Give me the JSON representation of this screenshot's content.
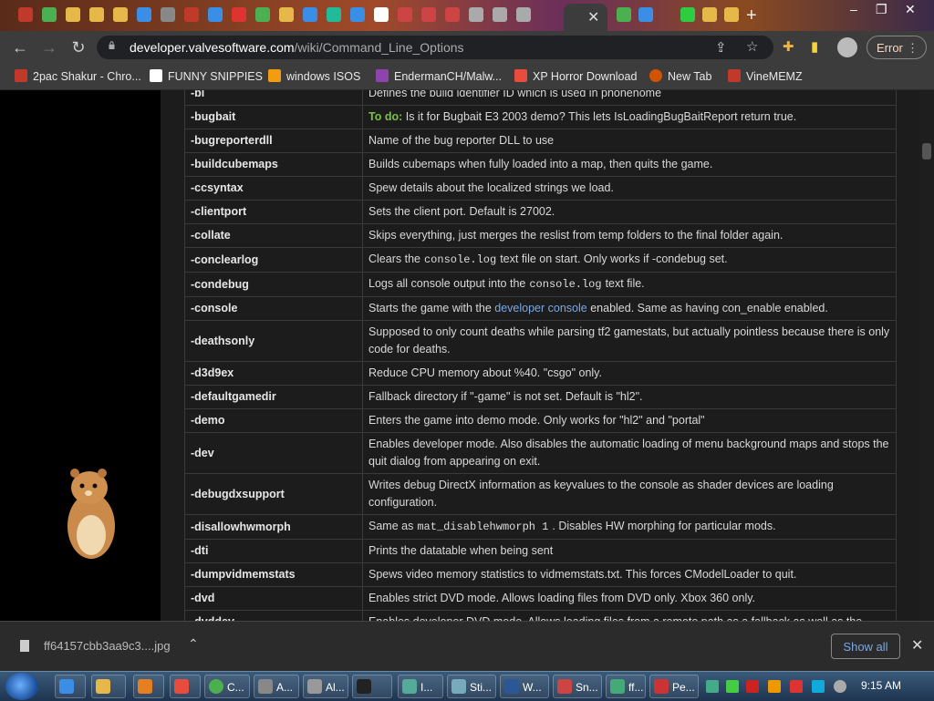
{
  "browser": {
    "url_host": "developer.valvesoftware.com",
    "url_path": "/wiki/Command_Line_Options",
    "error_label": "Error"
  },
  "bookmarks": [
    {
      "label": "2pac Shakur - Chro...",
      "color": "#c0392b"
    },
    {
      "label": "FUNNY SNIPPIES",
      "color": "#ffffff"
    },
    {
      "label": "windows ISOS",
      "color": "#f39c12"
    },
    {
      "label": "EndermanCH/Malw...",
      "color": "#8e44ad"
    },
    {
      "label": "XP Horror Download",
      "color": "#e74c3c"
    },
    {
      "label": "New Tab",
      "color": "#d35400"
    },
    {
      "label": "VineMEMZ",
      "color": "#c0392b"
    }
  ],
  "table": {
    "rows": [
      {
        "name": "-bi",
        "desc": "Defines the build identifier ID which is used in phonehome"
      },
      {
        "name": "-bugbait",
        "todo": "To do:",
        "desc": " Is it for Bugbait E3 2003 demo? This lets IsLoadingBugBaitReport return true."
      },
      {
        "name": "-bugreporterdll",
        "desc": "Name of the bug reporter DLL to use"
      },
      {
        "name": "-buildcubemaps",
        "desc": "Builds cubemaps when fully loaded into a map, then quits the game."
      },
      {
        "name": "-ccsyntax",
        "desc": "Spew details about the localized strings we load."
      },
      {
        "name": "-clientport",
        "desc": "Sets the client port. Default is 27002."
      },
      {
        "name": "-collate",
        "desc": "Skips everything, just merges the reslist from temp folders to the final folder again."
      },
      {
        "name": "-conclearlog",
        "pre": "Clears the",
        "code": "console.log",
        "post": "text file on start. Only works if -condebug set."
      },
      {
        "name": "-condebug",
        "pre": "Logs all console output into the",
        "code": "console.log",
        "post": "text file."
      },
      {
        "name": "-console",
        "pre": "Starts the game with the ",
        "link": "developer console",
        "post": " enabled. Same as having con_enable enabled."
      },
      {
        "name": "-deathsonly",
        "desc": "Supposed to only count deaths while parsing tf2 gamestats, but actually pointless because there is only code for deaths."
      },
      {
        "name": "-d3d9ex",
        "desc": "Reduce CPU memory about %40. \"csgo\" only."
      },
      {
        "name": "-defaultgamedir",
        "desc": "Fallback directory if \"-game\" is not set. Default is \"hl2\"."
      },
      {
        "name": "-demo",
        "desc": "Enters the game into demo mode. Only works for \"hl2\" and \"portal\""
      },
      {
        "name": "-dev",
        "desc": "Enables developer mode. Also disables the automatic loading of menu background maps and stops the quit dialog from appearing on exit."
      },
      {
        "name": "-debugdxsupport",
        "desc": "Writes debug DirectX information as keyvalues to the console as shader devices are loading configuration."
      },
      {
        "name": "-disallowhwmorph",
        "pre": "Same as",
        "code": "mat_disablehwmorph 1",
        "post": ". Disables HW morphing for particular mods."
      },
      {
        "name": "-dti",
        "desc": "Prints the datatable when being sent"
      },
      {
        "name": "-dumpvidmemstats",
        "desc": "Spews video memory statistics to vidmemstats.txt. This forces CModelLoader to quit."
      },
      {
        "name": "-dvd",
        "desc": "Enables strict DVD mode. Allows loading files from DVD only. Xbox 360 only."
      },
      {
        "name": "-dvddev",
        "desc": "Enables developer DVD mode. Allows loading files from a remote path as a fallback as well as the"
      }
    ]
  },
  "download": {
    "filename": "ff64157cbb3aa9c3....jpg",
    "show_all": "Show all"
  },
  "taskbar": {
    "buttons": [
      "C...",
      "A...",
      "Al...",
      "I...",
      "Sti...",
      "W...",
      "Sn...",
      "ff...",
      "Pe..."
    ],
    "clock": "9:15 AM"
  }
}
